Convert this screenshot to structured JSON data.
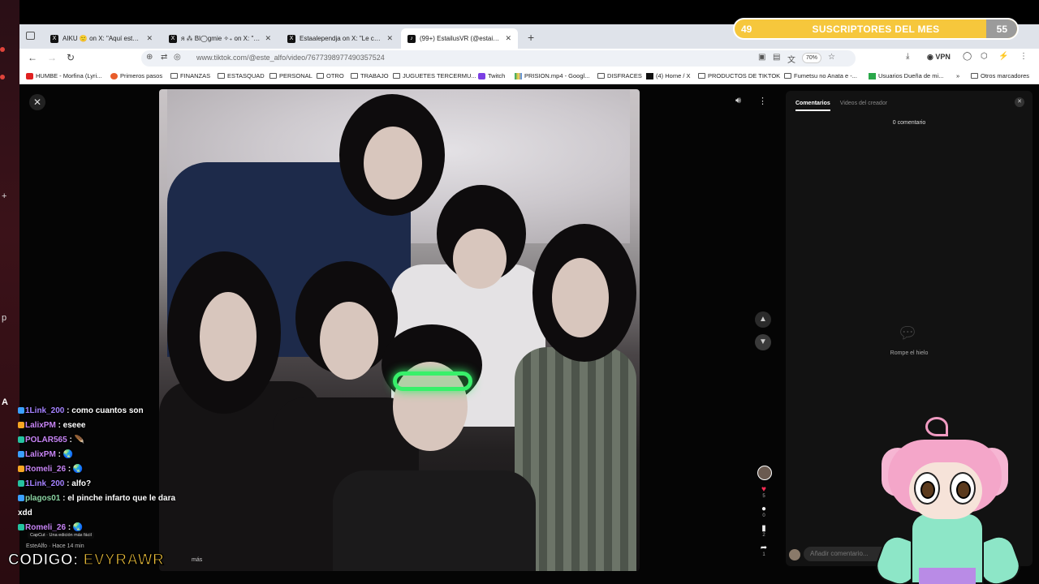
{
  "subscribers": {
    "current": "49",
    "goal": "55",
    "label": "SUSCRIPTORES DEL MES",
    "progress_fraction": 0.89
  },
  "browser": {
    "tabs": [
      {
        "label": "AIKU 🙂 on X: \"Aquí está mi hu",
        "icon": "x-logo"
      },
      {
        "label": "ᴙ ⁂ Bl◯gmie ✧₊ on X: \"Intro d",
        "icon": "x-logo"
      },
      {
        "label": "Estaalependja on X: \"Le cambie",
        "icon": "x-logo"
      },
      {
        "label": "(99+) EstailusVR (@estailus",
        "icon": "tiktok-logo",
        "active": true
      }
    ],
    "url": "www.tiktok.com/@este_alfo/video/7677398977490357524",
    "zoom": "70%",
    "vpn_label": "VPN",
    "bookmarks": [
      {
        "label": "HUMBE - Morfina (Lyri...",
        "icon": "youtube"
      },
      {
        "label": "Primeros pasos",
        "icon": "firefox"
      },
      {
        "label": "FINANZAS",
        "icon": "folder"
      },
      {
        "label": "ESTASQUAD",
        "icon": "folder"
      },
      {
        "label": "PERSONAL",
        "icon": "folder"
      },
      {
        "label": "OTRO",
        "icon": "folder"
      },
      {
        "label": "TRABAJO",
        "icon": "folder"
      },
      {
        "label": "JUGUETES TERCERMU...",
        "icon": "folder"
      },
      {
        "label": "Twitch",
        "icon": "twitch"
      },
      {
        "label": "PRISION.mp4 - Googl...",
        "icon": "drive"
      },
      {
        "label": "DISFRACES",
        "icon": "folder"
      },
      {
        "label": "(4) Home / X",
        "icon": "x-logo"
      },
      {
        "label": "PRODUCTOS DE TIKTOK",
        "icon": "folder"
      },
      {
        "label": "Fumetsu no Anata e -...",
        "icon": "folder"
      },
      {
        "label": "Usuarios Dueña de mi...",
        "icon": "green"
      },
      {
        "label": "Otros marcadores",
        "icon": "folder"
      }
    ]
  },
  "comments_panel": {
    "tab_comments": "Comentarios",
    "tab_creator": "Videos del creador",
    "count": "0 comentario",
    "empty_text": "Rompe el hielo",
    "input_placeholder": "Añadir comentario..."
  },
  "video": {
    "creator_line": "EsteAlfo · Hace 14 min",
    "capcut_badge": "CapCut · Una edición más fácil",
    "more_label": "más",
    "likes": "5",
    "comments": "0",
    "saves": "2",
    "shares": "1"
  },
  "chat": {
    "messages": [
      {
        "user": "1Link_200",
        "text": ": como cuantos son",
        "color": "b"
      },
      {
        "user": "LalixPM",
        "text": ": eseee",
        "color": "p"
      },
      {
        "user": "POLAR565",
        "text": ": 🪶",
        "color": "p"
      },
      {
        "user": "LalixPM",
        "text": ": 🌏",
        "color": "p"
      },
      {
        "user": "Romeli_26",
        "text": ": 🌏",
        "color": "p"
      },
      {
        "user": "1Link_200",
        "text": ": alfo?",
        "color": "b"
      },
      {
        "user": "plagos01",
        "text": ": el pinche infarto que le dara",
        "color": "g"
      },
      {
        "user": "",
        "text": "xdd",
        "color": "g"
      },
      {
        "user": "Romeli_26",
        "text": ": 🌏",
        "color": "p"
      }
    ],
    "code_label": "CODIGO:",
    "code_value": "EVYRAWR"
  }
}
